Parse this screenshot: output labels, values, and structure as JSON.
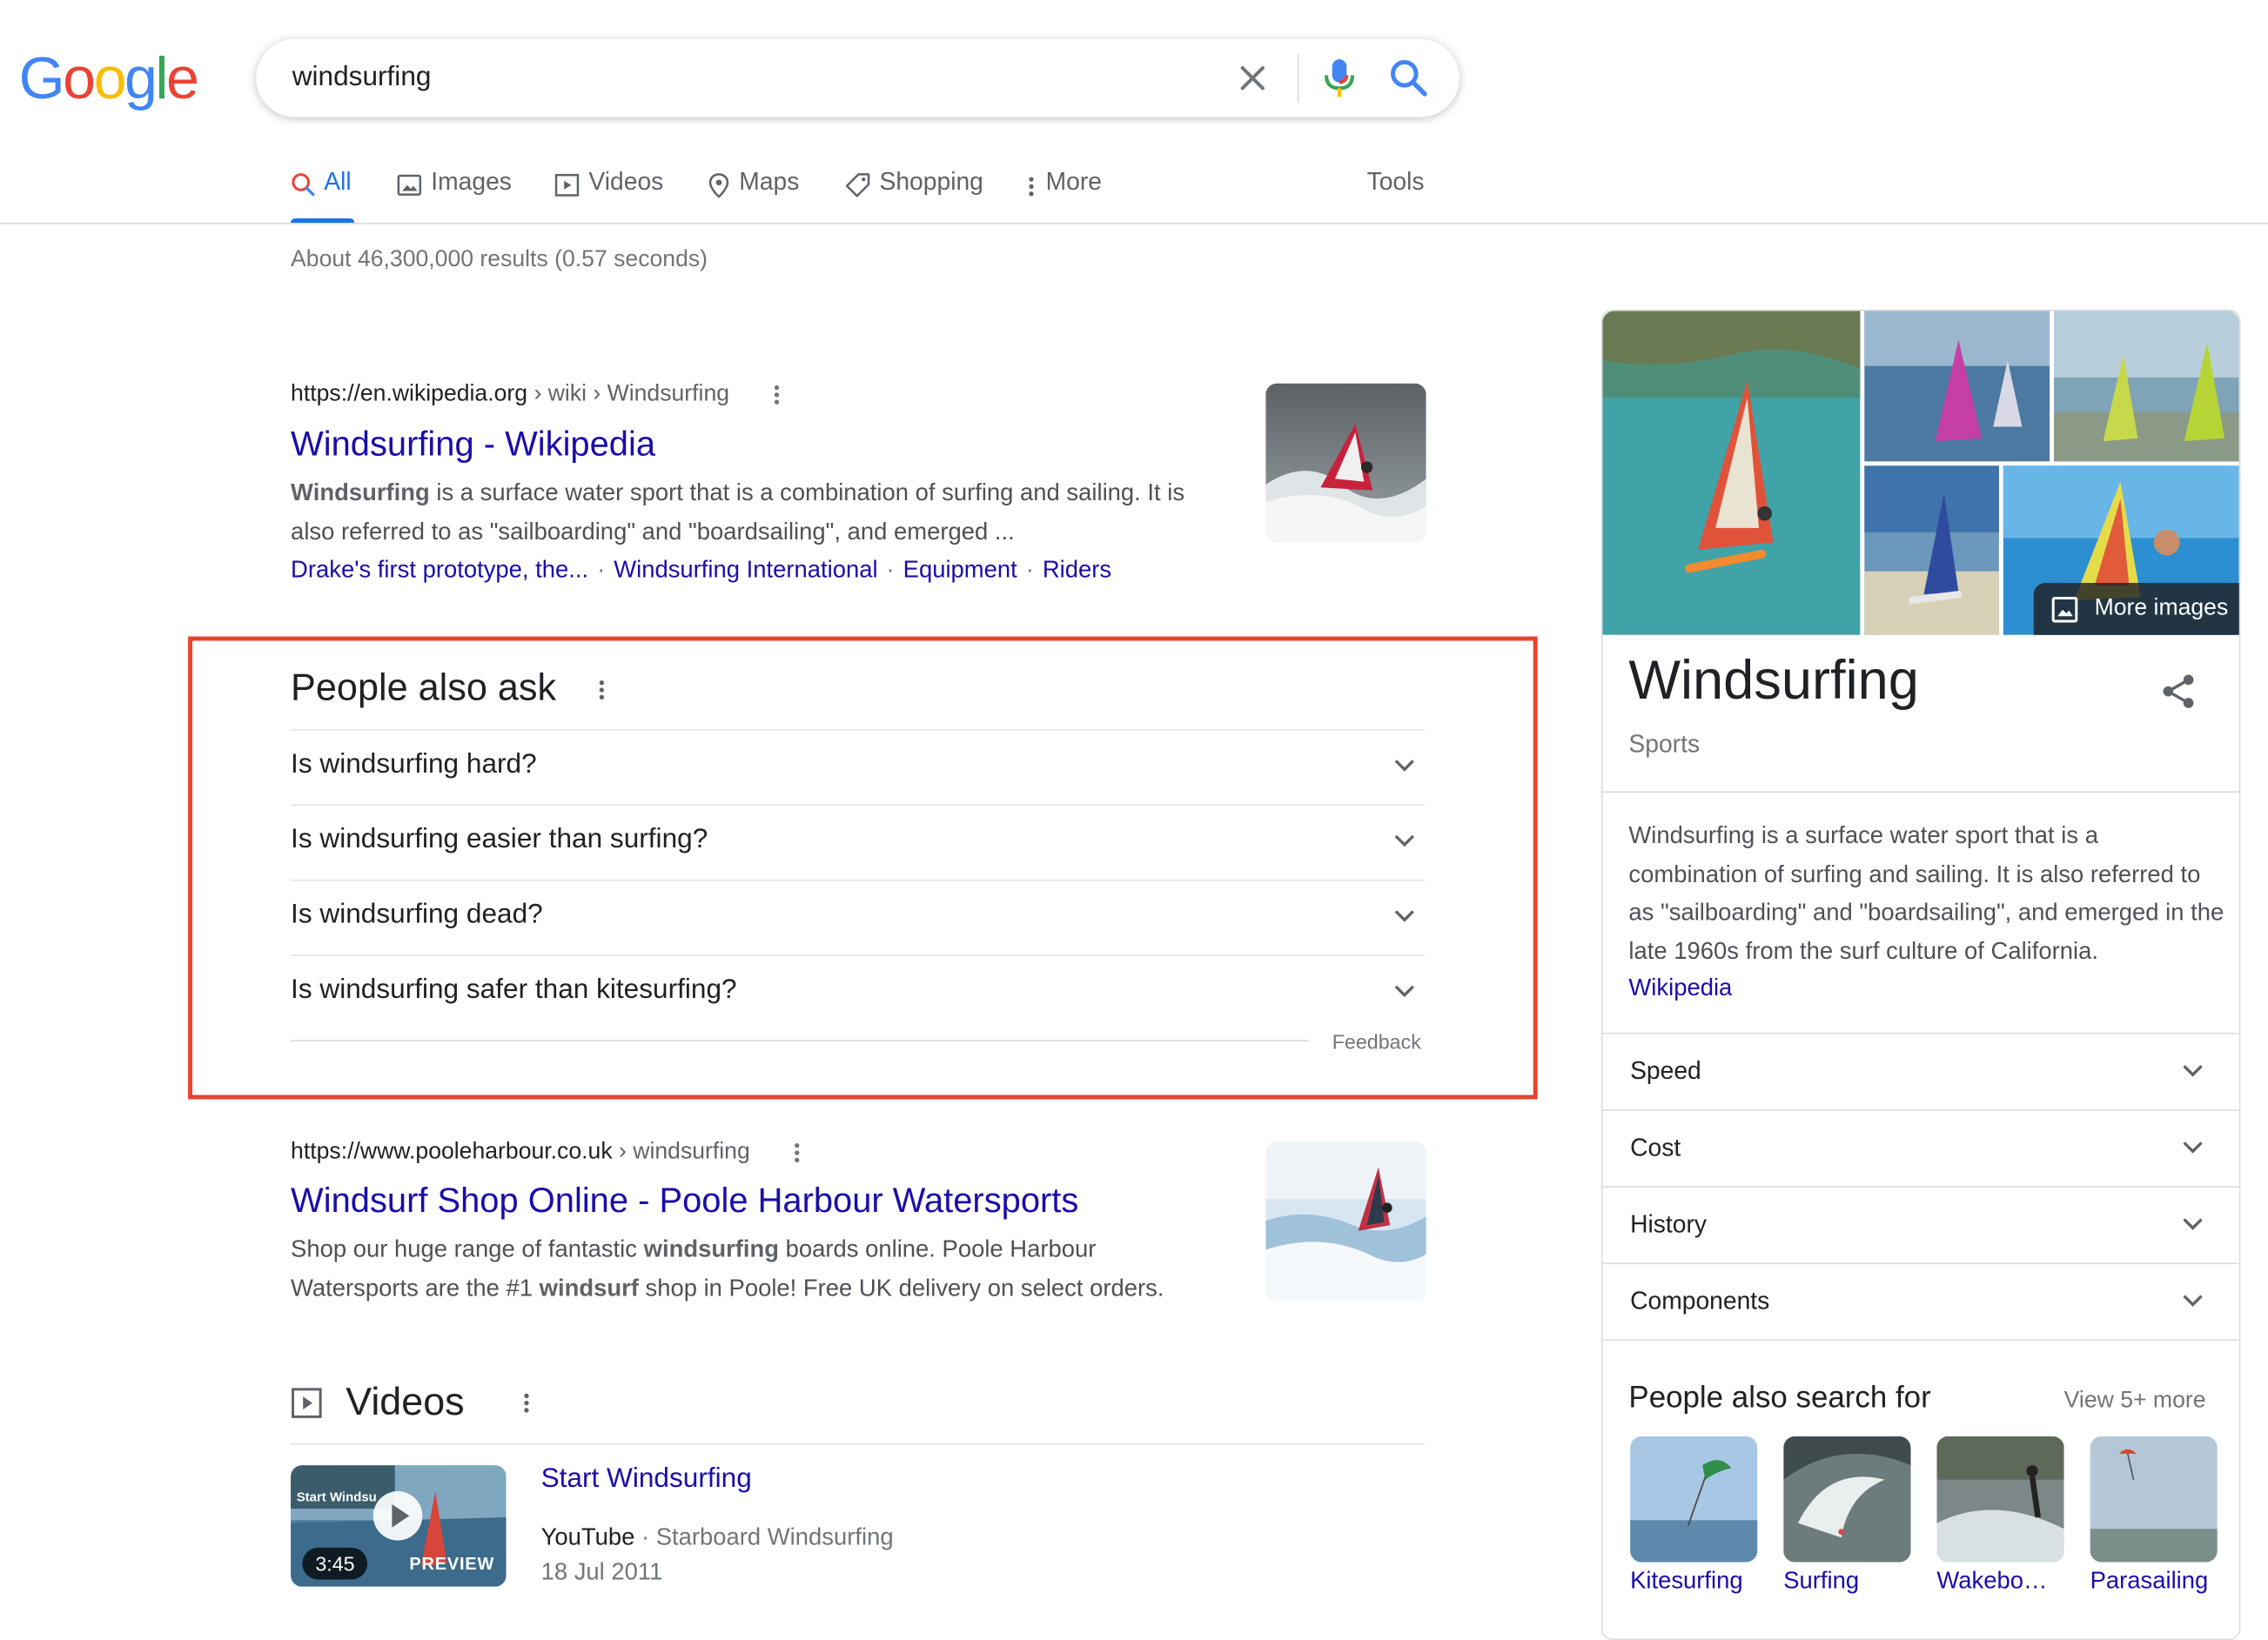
{
  "logo": {
    "text": "Google",
    "letters": [
      "G",
      "o",
      "o",
      "g",
      "l",
      "e"
    ],
    "colors": [
      "#4285F4",
      "#EA4335",
      "#FBBC05",
      "#4285F4",
      "#34A853",
      "#EA4335"
    ]
  },
  "search": {
    "query": "windsurfing",
    "placeholder": ""
  },
  "tabs": [
    {
      "label": "All",
      "icon": "search-icon",
      "active": true
    },
    {
      "label": "Images",
      "icon": "image-icon"
    },
    {
      "label": "Videos",
      "icon": "play-icon"
    },
    {
      "label": "Maps",
      "icon": "map-pin-icon"
    },
    {
      "label": "Shopping",
      "icon": "tag-icon"
    },
    {
      "label": "More",
      "icon": "more-vert-icon"
    }
  ],
  "tools_label": "Tools",
  "stats": "About 46,300,000 results (0.57 seconds)",
  "results": [
    {
      "cite_domain": "https://en.wikipedia.org",
      "cite_path": " › wiki › Windsurfing",
      "title": "Windsurfing - Wikipedia",
      "snippet_b1": "Windsurfing",
      "snippet_rest": " is a surface water sport that is a combination of surfing and sailing. It is also referred to as \"sailboarding\" and \"boardsailing\", and emerged ...",
      "sitelinks": [
        "Drake's first prototype, the...",
        "Windsurfing International",
        "Equipment",
        "Riders"
      ]
    },
    {
      "cite_domain": "https://www.pooleharbour.co.uk",
      "cite_path": " › windsurfing",
      "title": "Windsurf Shop Online - Poole Harbour Watersports",
      "s1": "Shop our huge range of fantastic ",
      "b1": "windsurfing",
      "s2": " boards online. Poole Harbour Watersports are the #1 ",
      "b2": "windsurf",
      "s3": " shop in Poole! Free UK delivery on select orders."
    }
  ],
  "paa": {
    "title": "People also ask",
    "questions": [
      "Is windsurfing hard?",
      "Is windsurfing easier than surfing?",
      "Is windsurfing dead?",
      "Is windsurfing safer than kitesurfing?"
    ],
    "feedback": "Feedback"
  },
  "videos": {
    "heading": "Videos",
    "items": [
      {
        "title": "Start Windsurfing",
        "source": "YouTube",
        "channel": "Starboard Windsurfing",
        "date": "18 Jul 2011",
        "duration": "3:45",
        "badge": "PREVIEW",
        "thumb_text": "Start Windsu"
      }
    ]
  },
  "knowledge_panel": {
    "title": "Windsurfing",
    "subtitle": "Sports",
    "description": "Windsurfing is a surface water sport that is a combination of surfing and sailing. It is also referred to as \"sailboarding\" and \"boardsailing\", and emerged in the late 1960s from the surf culture of California.",
    "source_link": "Wikipedia",
    "more_images": "More images",
    "rows": [
      "Speed",
      "Cost",
      "History",
      "Components"
    ],
    "pasf_title": "People also search for",
    "pasf_more": "View 5+ more",
    "pasf": [
      "Kitesurfing",
      "Surfing",
      "Wakebo…",
      "Parasailing"
    ]
  },
  "colors": {
    "link": "#1a0dab",
    "accent": "#1a73e8",
    "highlight_border": "#e8432f"
  }
}
